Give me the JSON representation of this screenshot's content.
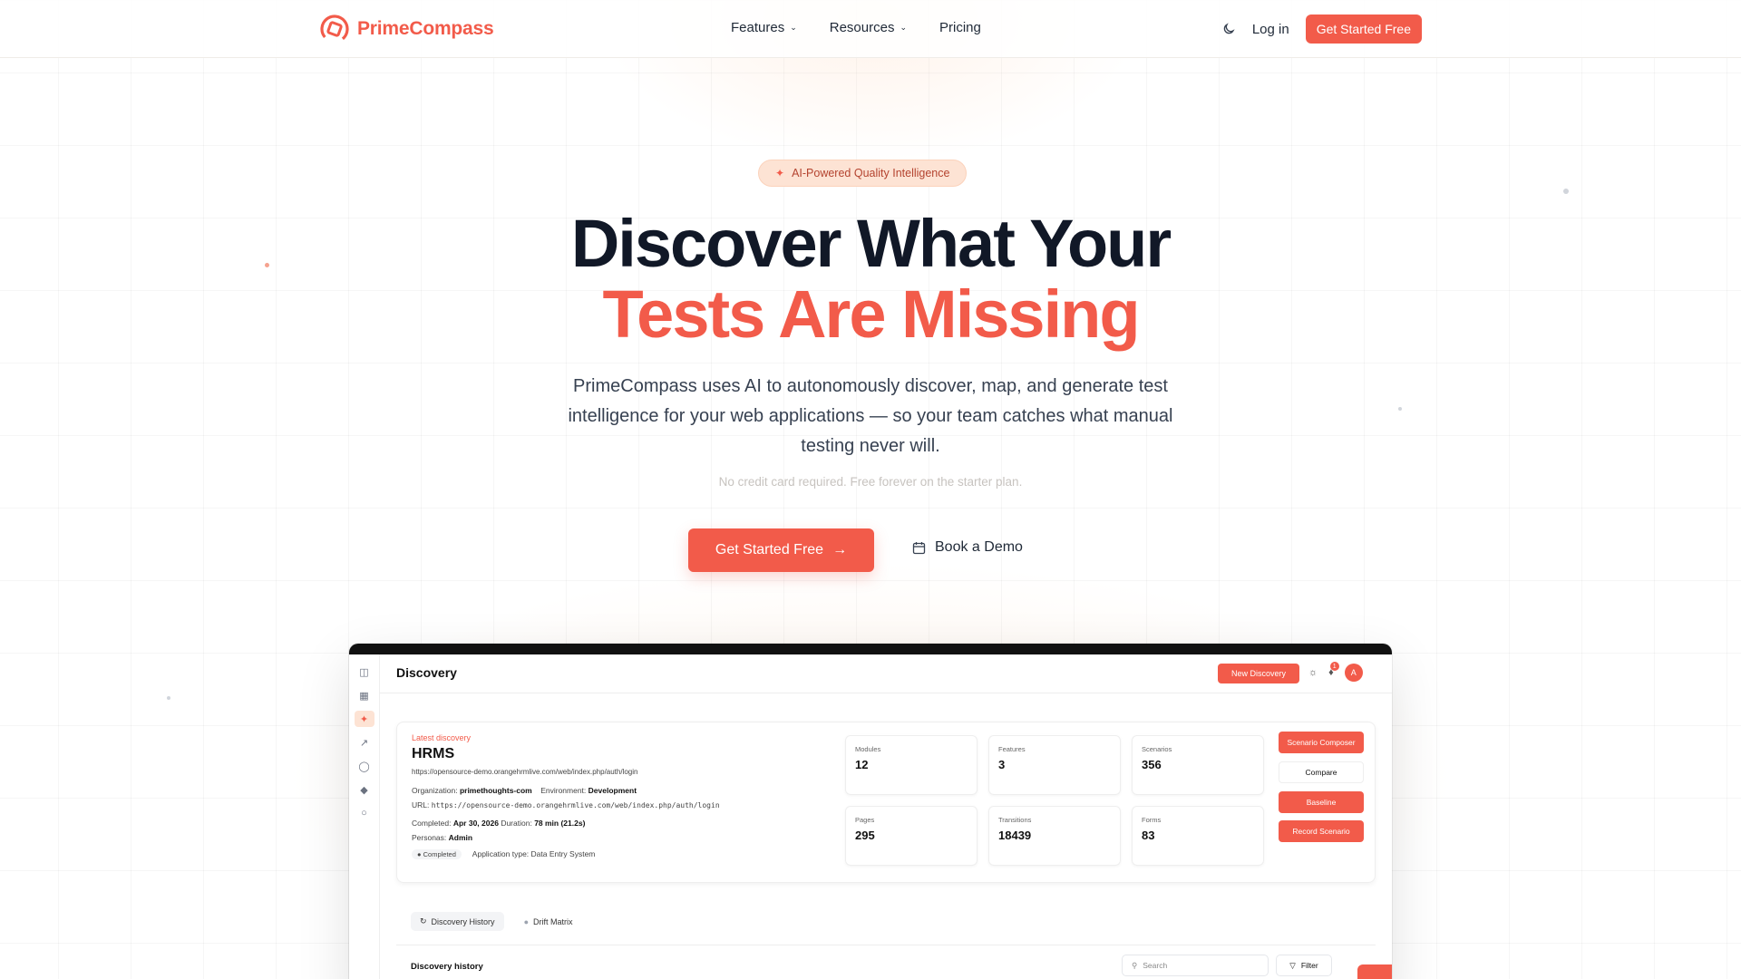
{
  "nav": {
    "brand": "PrimeCompass",
    "links": [
      {
        "label": "Features",
        "has_dropdown": true
      },
      {
        "label": "Resources",
        "has_dropdown": true
      },
      {
        "label": "Pricing",
        "has_dropdown": false
      }
    ],
    "login_label": "Log in",
    "cta_label": "Get Started Free"
  },
  "hero": {
    "badge": "AI-Powered Quality Intelligence",
    "headline_line1": "Discover What Your",
    "headline_line2": "Tests Are Missing",
    "subtitle": "PrimeCompass uses AI to autonomously discover, map, and generate test intelligence for your web applications — so your team catches what manual testing never will.",
    "note": "No credit card required. Free forever on the starter plan.",
    "primary_cta": "Get Started Free",
    "secondary_cta": "Book a Demo"
  },
  "preview": {
    "page_title": "Discovery",
    "new_button": "New Discovery",
    "avatar_initial": "A",
    "notification_count": "1",
    "latest_label": "Latest discovery",
    "app_name": "HRMS",
    "app_url": "https://opensource-demo.orangehrmlive.com/web/index.php/auth/login",
    "organization_label": "Organization:",
    "organization": "primethoughts-com",
    "environment_label": "Environment:",
    "environment": "Development",
    "url_label": "URL:",
    "url_value": "https://opensource-demo.orangehrmlive.com/web/index.php/auth/login",
    "completed_label": "Completed:",
    "completed": "Apr 30, 2026",
    "duration_label": "Duration:",
    "duration": "78 min (21.2s)",
    "personas_label": "Personas:",
    "personas": "Admin",
    "status_chip": "● Completed",
    "app_type": "Application type: Data Entry System",
    "stats": [
      {
        "label": "Modules",
        "value": "12"
      },
      {
        "label": "Features",
        "value": "3"
      },
      {
        "label": "Scenarios",
        "value": "356"
      },
      {
        "label": "Pages",
        "value": "295"
      },
      {
        "label": "Transitions",
        "value": "18439"
      },
      {
        "label": "Forms",
        "value": "83"
      }
    ],
    "actions": [
      "Scenario Composer",
      "Compare",
      "Baseline",
      "Record Scenario"
    ],
    "tabs": [
      "Discovery History",
      "Drift Matrix"
    ],
    "history_title": "Discovery history",
    "search_placeholder": "Search",
    "filter_label": "Filter"
  },
  "colors": {
    "brand": "#f25b4a",
    "text_dark": "#111827",
    "badge_bg": "#fde3d4"
  }
}
